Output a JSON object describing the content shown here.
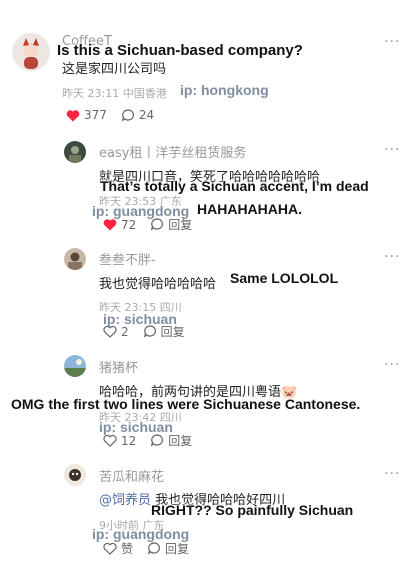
{
  "top_comment": {
    "user": "CoffeeT",
    "text_zh": "这是家四川公司吗",
    "text_en": "Is this a Sichuan-based company?",
    "meta": "昨天 23:11 中国香港",
    "ip_en": "ip: hongkong",
    "likes": "377",
    "replies": "24",
    "more": "···"
  },
  "replies": [
    {
      "user": "easy租丨洋芋丝租赁服务",
      "text_zh": "就是四川口音，笑死了哈哈哈哈哈哈哈",
      "text_en_1": "That’s totally a Sichuan accent, I’m dead",
      "text_en_2": "HAHAHAHAHA.",
      "meta": "昨天 23:53 广东",
      "ip_en": "ip: guangdong",
      "likes": "72",
      "reply_label": "回复",
      "more": "···"
    },
    {
      "user": "叁叁不胖-",
      "text_zh": "我也觉得哈哈哈哈哈",
      "text_en": "Same LOLOLOL",
      "meta": "昨天 23:15 四川",
      "ip_en": "ip: sichuan",
      "likes": "2",
      "reply_label": "回复",
      "more": "···"
    },
    {
      "user": "猪猪杯",
      "text_zh": "哈哈哈，前两句讲的是四川粤语🐷",
      "text_en": "OMG the first two lines were Sichuanese Cantonese.",
      "meta": "昨天 23:42 四川",
      "ip_en": "ip: sichuan",
      "likes": "12",
      "reply_label": "回复",
      "more": "···"
    },
    {
      "user": "苦瓜和麻花",
      "mention": "@饲养员",
      "text_zh": "我也觉得哈哈哈好四川",
      "text_en": "RIGHT?? So painfully Sichuan",
      "meta": "9小时前 广东",
      "ip_en": "ip: guangdong",
      "likes": "赞",
      "reply_label": "回复",
      "more": "···"
    }
  ],
  "colors": {
    "heart_red": "#ff2442",
    "icon_gray": "#666666"
  }
}
